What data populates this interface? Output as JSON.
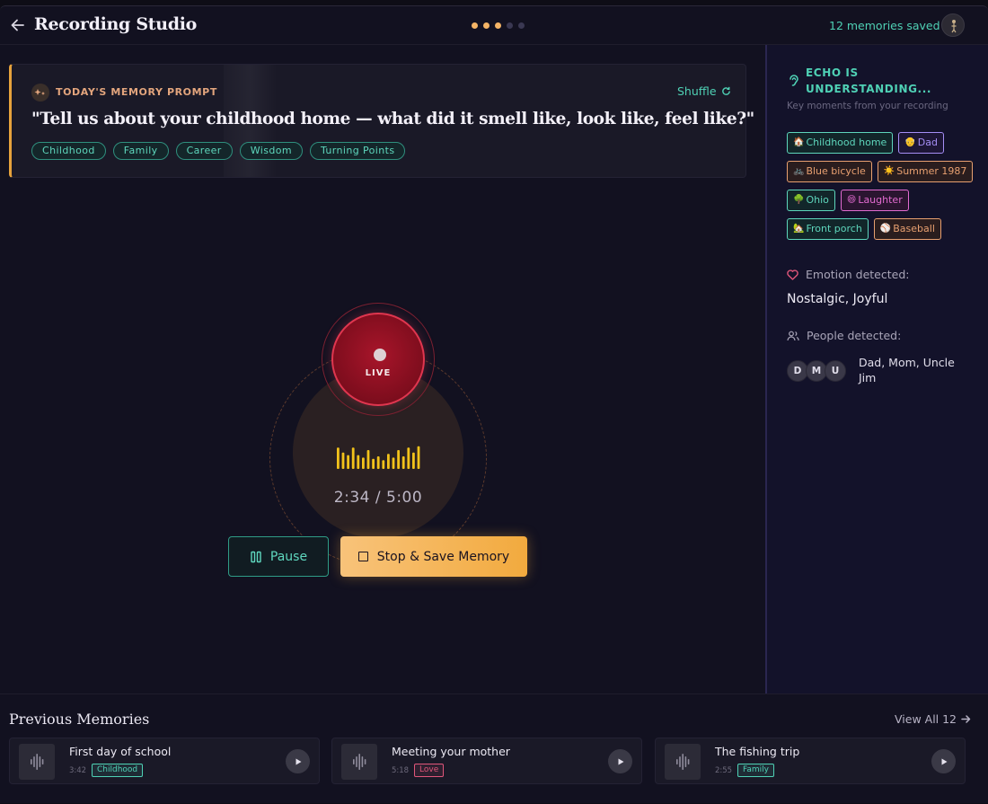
{
  "header": {
    "title": "Recording Studio",
    "memories_saved": "12 memories saved",
    "progress_dots": [
      "#f4b466",
      "#f4b466",
      "#f4b466",
      "#3a3852",
      "#3a3852"
    ]
  },
  "prompt": {
    "label": "TODAY'S MEMORY PROMPT",
    "shuffle": "Shuffle",
    "text": "\"Tell us about your childhood home — what did it smell like, look like, feel like?\"",
    "tags": [
      "Childhood",
      "Family",
      "Career",
      "Wisdom",
      "Turning Points"
    ]
  },
  "recorder": {
    "live_label": "LIVE",
    "timer": "2:34 / 5:00",
    "pause_label": "Pause",
    "stop_label": "Stop & Save Memory",
    "wave_levels": [
      0.85,
      0.65,
      0.55,
      0.85,
      0.55,
      0.45,
      0.75,
      0.4,
      0.5,
      0.35,
      0.6,
      0.45,
      0.75,
      0.5,
      0.85,
      0.65,
      0.9
    ]
  },
  "panel": {
    "title": "ECHO IS UNDERSTANDING...",
    "subtitle": "Key moments from your recording",
    "chips": [
      {
        "icon": "🏠",
        "label": "Childhood home",
        "color": "#5ed6bc",
        "bg": "#12262a"
      },
      {
        "icon": "👴",
        "label": "Dad",
        "color": "#a58ef5",
        "bg": "#1d1636"
      },
      {
        "icon": "🚲",
        "label": "Blue bicycle",
        "color": "#e8a070",
        "bg": "#2a1d1e"
      },
      {
        "icon": "☀️",
        "label": "Summer 1987",
        "color": "#e8a070",
        "bg": "#2a1d1e"
      },
      {
        "icon": "🌳",
        "label": "Ohio",
        "color": "#5ed6bc",
        "bg": "#12262a"
      },
      {
        "icon": "😄",
        "label": "Laughter",
        "color": "#e26bd0",
        "bg": "#2a1530"
      },
      {
        "icon": "🏡",
        "label": "Front porch",
        "color": "#5ed6bc",
        "bg": "#12262a"
      },
      {
        "icon": "⚾",
        "label": "Baseball",
        "color": "#e8a070",
        "bg": "#2a1d1e"
      }
    ],
    "emotion_label": "Emotion detected:",
    "emotion_value": "Nostalgic, Joyful",
    "people_label": "People detected:",
    "people_initials": [
      "D",
      "M",
      "U"
    ],
    "people_names": "Dad, Mom, Uncle Jim"
  },
  "previous": {
    "title": "Previous Memories",
    "view_all": "View All 12",
    "items": [
      {
        "title": "First day of school",
        "duration": "3:42",
        "tag": "Childhood",
        "tag_color": "#4fd1b5"
      },
      {
        "title": "Meeting your mother",
        "duration": "5:18",
        "tag": "Love",
        "tag_color": "#e0567a"
      },
      {
        "title": "The fishing trip",
        "duration": "2:55",
        "tag": "Family",
        "tag_color": "#4fd1b5"
      }
    ]
  }
}
